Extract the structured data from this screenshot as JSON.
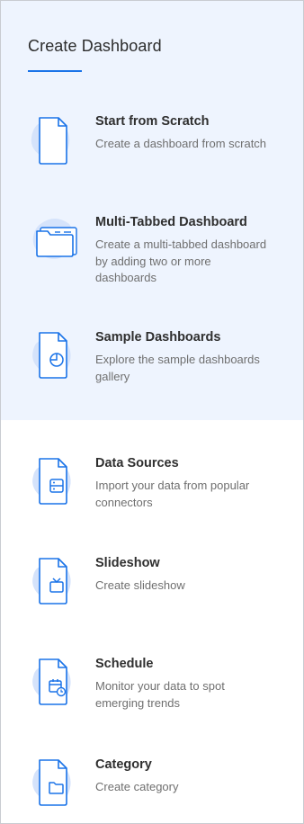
{
  "header": {
    "title": "Create Dashboard"
  },
  "colors": {
    "accent": "#1a73e8",
    "top_section_bg": "#eef4fe",
    "blob": "#d5e3fb"
  },
  "options": [
    {
      "title": "Start from Scratch",
      "description": "Create a dashboard from scratch",
      "icon": "blank-file-icon"
    },
    {
      "title": "Multi-Tabbed Dashboard",
      "description": "Create a multi-tabbed dashboard by adding two or more dashboards",
      "icon": "multi-tab-folder-icon"
    },
    {
      "title": "Sample Dashboards",
      "description": "Explore the sample dashboards gallery",
      "icon": "pie-chart-file-icon"
    },
    {
      "title": "Data Sources",
      "description": "Import your data from popular connectors",
      "icon": "database-file-icon"
    },
    {
      "title": "Slideshow",
      "description": "Create slideshow",
      "icon": "tv-file-icon"
    },
    {
      "title": "Schedule",
      "description": "Monitor your data to spot emerging trends",
      "icon": "calendar-clock-file-icon"
    },
    {
      "title": "Category",
      "description": "Create category",
      "icon": "folder-file-icon"
    }
  ]
}
